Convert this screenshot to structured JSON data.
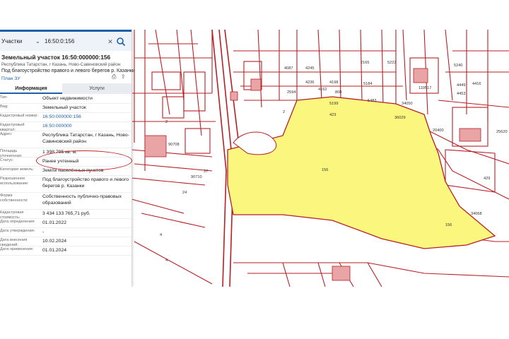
{
  "search": {
    "type_select": "Участки",
    "query": "16:50:0:156"
  },
  "object": {
    "title": "Земельный участок 16:50:000000:156",
    "address_line": "Республика Татарстан, г Казань, Ново-Савиновский район",
    "purpose_line": "Под благоустройство правого и левого берегов р. Казанки",
    "plan_link": "План ЗУ"
  },
  "tabs": [
    "Информация",
    "Услуги"
  ],
  "rows": [
    {
      "label": "Тип:",
      "value": "Объект недвижимости"
    },
    {
      "label": "Вид:",
      "value": "Земельный участок"
    },
    {
      "label": "Кадастровый номер:",
      "value": "16:50:000000:156",
      "link": true
    },
    {
      "label": "Кадастровый квартал:",
      "value": "16:50:000000",
      "link": true
    },
    {
      "label": "Адрес:",
      "value": "Республика Татарстан, г Казань, Ново-Савиновский район"
    },
    {
      "label": "Площадь уточненная:",
      "value": "1 398 795 кв. м."
    },
    {
      "label": "Статус:",
      "value": "Ранее учтенный"
    },
    {
      "label": "Категория земель:",
      "value": "Земли населённых пунктов"
    },
    {
      "label": "Разрешенное использование:",
      "value": "Под благоустройство правого и левого берегов р. Казанки"
    },
    {
      "label": "Форма собственности:",
      "value": "Собственность публично-правовых образований"
    },
    {
      "label": "Кадастровая стоимость:",
      "value": "3 434 133 765,71 руб."
    },
    {
      "label": "Дата определения:",
      "value": "01.01.2022"
    },
    {
      "label": "Дата утверждения:",
      "value": "-"
    },
    {
      "label": "Дата внесения сведений:",
      "value": "10.02.2024"
    },
    {
      "label": "Дата применения:",
      "value": "01.01.2024"
    }
  ],
  "map_labels": {
    "parcel_main": "156",
    "parcel_main_2": "156",
    "l1": "4087",
    "l2": "4245",
    "l3": "4236",
    "l4": "4198",
    "l5": "4162",
    "l6": "2165",
    "l7": "5222",
    "l8": "5184",
    "l9": "5199",
    "l10": "423",
    "l11": "34050",
    "l12": "36029",
    "l13": "20400",
    "l14": "2594",
    "l15": "808",
    "l16": "5483",
    "l17": "110517",
    "l18": "5240",
    "l19": "4416",
    "l20": "4449",
    "l21": "4453",
    "l22": "25620",
    "l23": "429",
    "l24": "34068",
    "l25": "2",
    "l26": "90708",
    "l27": "37",
    "l28": "90710",
    "l29": "24",
    "l30": "4",
    "l31": "4",
    "l32": "2"
  },
  "colors": {
    "accent": "#2060a8",
    "cadastre_line": "#b52025",
    "parcel_fill": "#fbf67e",
    "annotation": "#c0262a"
  },
  "icons": {
    "search": "magnifier-icon",
    "clear": "close-icon",
    "dropdown": "chevron-down-icon",
    "print": "printer-icon",
    "share": "share-icon"
  }
}
